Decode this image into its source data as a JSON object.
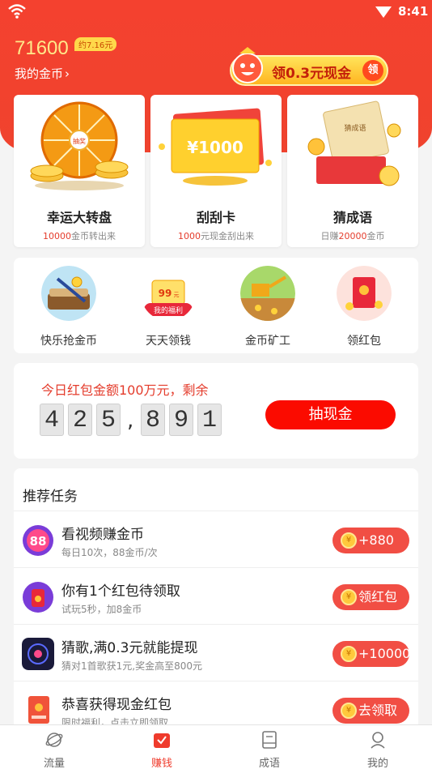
{
  "status": {
    "time": "8:41"
  },
  "header": {
    "coins": "71600",
    "coins_approx": "约7.16元",
    "my_coins_label": "我的金币",
    "chevron": "›",
    "banner_text": "领0.3元现金",
    "banner_button": "领"
  },
  "games": [
    {
      "title": "幸运大转盘",
      "sub_highlight": "10000",
      "sub_text": "金币转出来",
      "art_text": "抽奖"
    },
    {
      "title": "刮刮卡",
      "sub_highlight": "1000",
      "sub_text": "元现金刮出来",
      "art_text": "¥1000"
    },
    {
      "title": "猜成语",
      "sub_prefix": "日赚",
      "sub_highlight": "20000",
      "sub_text": "金币",
      "art_text": "猜成语"
    }
  ],
  "quick": [
    {
      "label": "快乐抢金币",
      "icon": "shovel-coins-icon"
    },
    {
      "label": "天天领钱",
      "icon": "welfare-icon",
      "badge": "99",
      "badge_unit": "元",
      "ribbon": "我的福利"
    },
    {
      "label": "金币矿工",
      "icon": "excavator-icon"
    },
    {
      "label": "领红包",
      "icon": "red-envelope-icon"
    }
  ],
  "draw": {
    "message": "今日红包金额100万元，剩余",
    "digits": [
      "4",
      "2",
      "5",
      "8",
      "9",
      "1"
    ],
    "separator": ",",
    "button": "抽现金"
  },
  "tasks": {
    "title": "推荐任务",
    "items": [
      {
        "name": "看视频赚金币",
        "sub": "每日10次，88金币/次",
        "button": "+880",
        "icon_text": "88"
      },
      {
        "name": "你有1个红包待领取",
        "sub": "试玩5秒，加8金币",
        "button": "领红包"
      },
      {
        "name": "猜歌,满0.3元就能提现",
        "sub": "猜对1首歌获1元,奖金高至800元",
        "button": "+10000"
      },
      {
        "name": "恭喜获得现金红包",
        "sub": "限时福利，点击立即领取",
        "button": "去领取"
      }
    ],
    "coin_glyph": "¥"
  },
  "nav": [
    {
      "label": "流量",
      "icon": "planet-icon",
      "active": false
    },
    {
      "label": "赚钱",
      "icon": "wallet-icon",
      "active": true
    },
    {
      "label": "成语",
      "icon": "book-icon",
      "active": false
    },
    {
      "label": "我的",
      "icon": "person-icon",
      "active": false
    }
  ],
  "colors": {
    "brand_red": "#f0432e",
    "button_red": "#fb0b00",
    "gold": "#ffe98a"
  }
}
